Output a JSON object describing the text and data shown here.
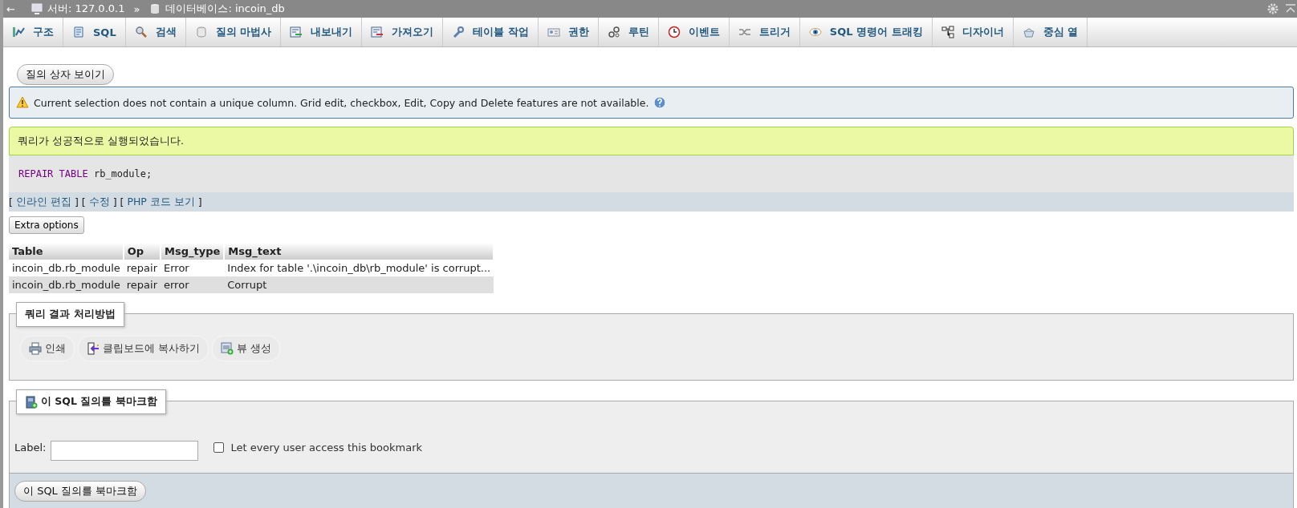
{
  "breadcrumb": {
    "back": "←",
    "server": "서버: 127.0.0.1",
    "separator": "»",
    "database": "데이터베이스: incoin_db"
  },
  "tabs": [
    {
      "label": "구조",
      "selected": false
    },
    {
      "label": "SQL",
      "selected": false
    },
    {
      "label": "검색",
      "selected": false
    },
    {
      "label": "질의 마법사",
      "selected": false
    },
    {
      "label": "내보내기",
      "selected": false
    },
    {
      "label": "가져오기",
      "selected": false
    },
    {
      "label": "테이블 작업",
      "selected": false
    },
    {
      "label": "권한",
      "selected": false
    },
    {
      "label": "루틴",
      "selected": false
    },
    {
      "label": "이벤트",
      "selected": false
    },
    {
      "label": "트리거",
      "selected": false
    },
    {
      "label": "SQL 명령어 트래킹",
      "selected": false
    },
    {
      "label": "디자이너",
      "selected": false
    },
    {
      "label": "중심 열",
      "selected": false
    }
  ],
  "query_box_button": "질의 상자 보이기",
  "warning": "Current selection does not contain a unique column. Grid edit, checkbox, Edit, Copy and Delete features are not available.",
  "success": {
    "message": "쿼리가 성공적으로 실행되었습니다.",
    "sql_keyword": "REPAIR TABLE",
    "sql_rest": "rb_module;",
    "links": [
      {
        "open": "[",
        "label": "인라인 편집",
        "close": "]"
      },
      {
        "open": "[",
        "label": "수정",
        "close": "]"
      },
      {
        "open": "[",
        "label": "PHP 코드 보기",
        "close": "]"
      }
    ]
  },
  "extra_options": "Extra options",
  "table": {
    "columns": [
      "Table",
      "Op",
      "Msg_type",
      "Msg_text"
    ],
    "rows": [
      [
        "incoin_db.rb_module",
        "repair",
        "Error",
        "Index for table '.\\incoin_db\\rb_module' is corrupt..."
      ],
      [
        "incoin_db.rb_module",
        "repair",
        "error",
        "Corrupt"
      ]
    ]
  },
  "operations": {
    "legend": "쿼리 결과 처리방법",
    "actions": [
      "인쇄",
      "클립보드에 복사하기",
      "뷰 생성"
    ]
  },
  "bookmark": {
    "legend": "이 SQL 질의를 북마크함",
    "label": "Label:",
    "shared_label": "Let every user access this bookmark",
    "shared_checked": false,
    "submit": "이 SQL 질의를 북마크함"
  }
}
